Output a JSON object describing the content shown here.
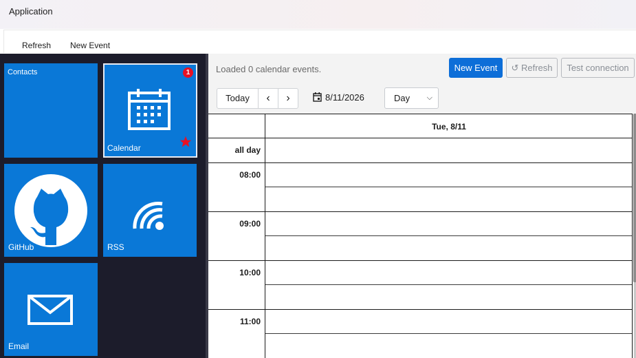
{
  "window": {
    "title": "Application"
  },
  "menu": {
    "refresh": "Refresh",
    "new_event": "New Event"
  },
  "tiles": [
    {
      "label": "Contacts",
      "icon": "contacts-tile"
    },
    {
      "label": "Calendar",
      "icon": "calendar-icon",
      "badge": "1",
      "favorite": "star-icon"
    },
    {
      "label": "GitHub",
      "icon": "github-icon"
    },
    {
      "label": "RSS",
      "icon": "rss-icon"
    },
    {
      "label": "Email",
      "icon": "email-icon"
    }
  ],
  "toolbar": {
    "status": "Loaded 0 calendar events.",
    "new_event": "New Event",
    "refresh": "↺ Refresh",
    "test_connection": "Test connection"
  },
  "calendar": {
    "today": "Today",
    "prev": "‹",
    "next": "›",
    "date": "8/11/2026",
    "view": "Day",
    "day_header": "Tue, 8/11",
    "all_day": "all day",
    "hours": [
      "08:00",
      "09:00",
      "10:00",
      "11:00"
    ]
  },
  "colors": {
    "tile": "#0a78d7",
    "sidebar": "#1c1c2b",
    "primary": "#0d6ed8",
    "badge": "#e81123"
  }
}
